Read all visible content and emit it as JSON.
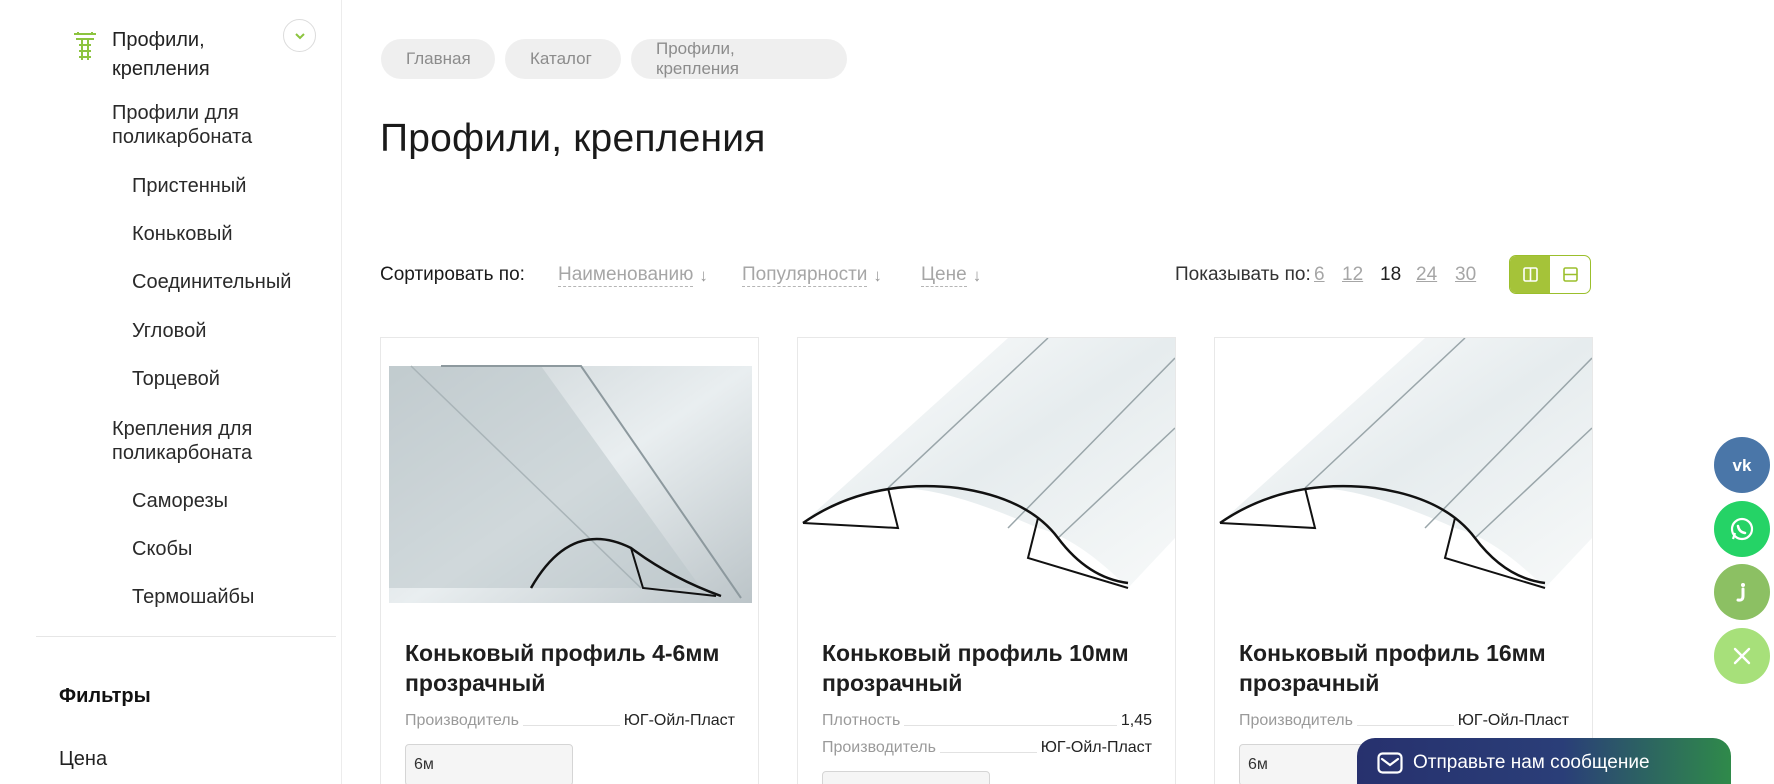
{
  "sidebar": {
    "category": "Профили, крепления",
    "items": [
      {
        "label": "Профили для поликарбоната"
      },
      {
        "label": "Пристенный"
      },
      {
        "label": "Коньковый"
      },
      {
        "label": "Соединительный"
      },
      {
        "label": "Угловой"
      },
      {
        "label": "Торцевой"
      },
      {
        "label": "Крепления для поликарбоната"
      },
      {
        "label": "Саморезы"
      },
      {
        "label": "Скобы"
      },
      {
        "label": "Термошайбы"
      }
    ],
    "filters_title": "Фильтры",
    "filter_price": "Цена"
  },
  "breadcrumb": [
    "Главная",
    "Каталог",
    "Профили, крепления"
  ],
  "page_title": "Профили, крепления",
  "sort": {
    "label": "Сортировать по:",
    "options": [
      "Наименованию",
      "Популярности",
      "Цене"
    ]
  },
  "show": {
    "label": "Показывать по:",
    "options": [
      "6",
      "12",
      "18",
      "24",
      "30"
    ],
    "active": "18"
  },
  "products": [
    {
      "name": "Коньковый профиль 4-6мм прозрачный",
      "props": [
        {
          "k": "Производитель",
          "v": "ЮГ-Ойл-Пласт"
        }
      ],
      "size": "6м"
    },
    {
      "name": "Коньковый профиль 10мм прозрачный",
      "props": [
        {
          "k": "Плотность",
          "v": "1,45"
        },
        {
          "k": "Производитель",
          "v": "ЮГ-Ойл-Пласт"
        }
      ],
      "size": ""
    },
    {
      "name": "Коньковый профиль 16мм прозрачный",
      "props": [
        {
          "k": "Производитель",
          "v": "ЮГ-Ойл-Пласт"
        }
      ],
      "size": "6м"
    }
  ],
  "social": [
    {
      "icon": "vk-icon",
      "color": "#4a76a8"
    },
    {
      "icon": "whatsapp-icon",
      "color": "#25d366"
    },
    {
      "icon": "jivo-icon",
      "color": "#8cc063"
    },
    {
      "icon": "close-icon",
      "color": "#a7e07a"
    }
  ],
  "message_widget": "Отправьте нам сообщение",
  "colors": {
    "accent": "#a5c339"
  }
}
